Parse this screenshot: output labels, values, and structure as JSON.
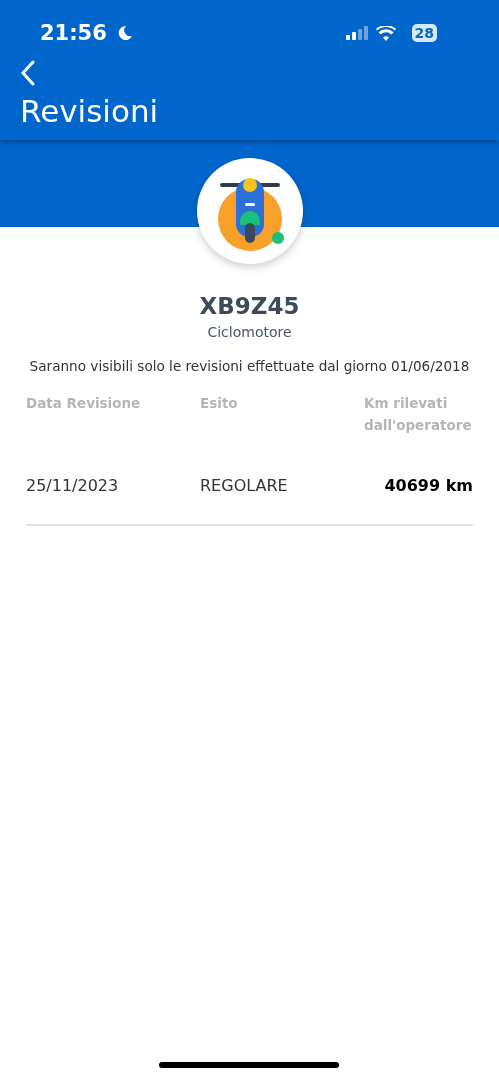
{
  "status_bar": {
    "time": "21:56",
    "battery": "28"
  },
  "header": {
    "title": "Revisioni"
  },
  "vehicle": {
    "plate": "XB9Z45",
    "type": "Ciclomotore"
  },
  "notice": "Saranno visibili solo le revisioni effettuate dal giorno 01/06/2018",
  "table": {
    "columns": [
      "Data Revisione",
      "Esito",
      "Km rilevati dall'operatore"
    ],
    "rows": [
      {
        "date": "25/11/2023",
        "result": "REGOLARE",
        "km": "40699 km"
      }
    ]
  }
}
